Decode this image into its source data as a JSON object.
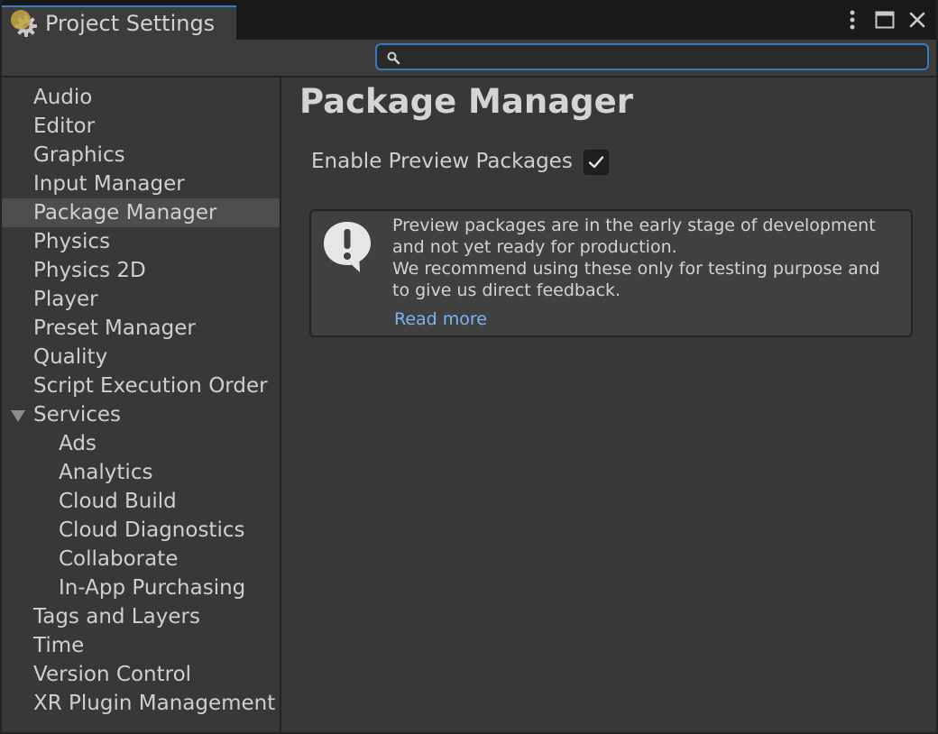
{
  "window": {
    "title": "Project Settings",
    "icon": "gear-icon",
    "controls": [
      "more-options-icon",
      "maximize-icon",
      "close-icon"
    ]
  },
  "search": {
    "value": "",
    "placeholder": ""
  },
  "sidebar": {
    "items": [
      {
        "label": "Audio"
      },
      {
        "label": "Editor"
      },
      {
        "label": "Graphics"
      },
      {
        "label": "Input Manager"
      },
      {
        "label": "Package Manager",
        "selected": true
      },
      {
        "label": "Physics"
      },
      {
        "label": "Physics 2D"
      },
      {
        "label": "Player"
      },
      {
        "label": "Preset Manager"
      },
      {
        "label": "Quality"
      },
      {
        "label": "Script Execution Order"
      },
      {
        "label": "Services",
        "expanded": true
      },
      {
        "label": "Ads",
        "child": true
      },
      {
        "label": "Analytics",
        "child": true
      },
      {
        "label": "Cloud Build",
        "child": true
      },
      {
        "label": "Cloud Diagnostics",
        "child": true
      },
      {
        "label": "Collaborate",
        "child": true
      },
      {
        "label": "In-App Purchasing",
        "child": true
      },
      {
        "label": "Tags and Layers"
      },
      {
        "label": "Time"
      },
      {
        "label": "Version Control"
      },
      {
        "label": "XR Plugin Management"
      }
    ]
  },
  "main": {
    "title": "Package Manager",
    "enable_preview": {
      "label": "Enable Preview Packages",
      "checked": true
    },
    "help": {
      "icon": "warning-speech-bubble-icon",
      "lines": [
        "Preview packages are in the early stage of development",
        "and not yet ready for production.",
        "We recommend using these only for testing purpose and",
        "to give us direct feedback."
      ],
      "link": "Read more"
    }
  },
  "colors": {
    "background": "#383838",
    "titlebar": "#191919",
    "accent": "#3a79bb",
    "selected_item": "#4d4d4d",
    "link": "#7ab3f5"
  }
}
